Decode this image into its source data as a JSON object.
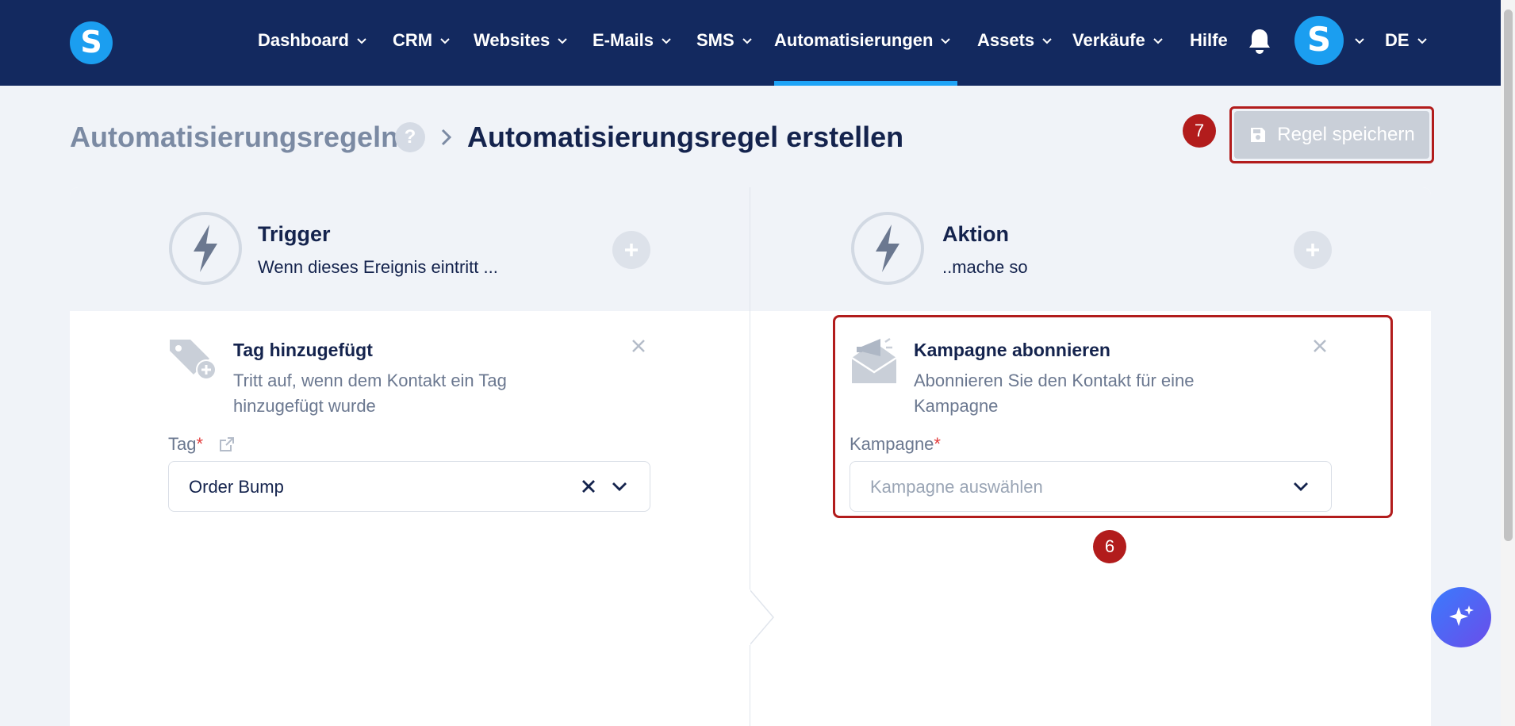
{
  "navbar": {
    "logo_letter": "S",
    "items": [
      {
        "label": "Dashboard"
      },
      {
        "label": "CRM"
      },
      {
        "label": "Websites"
      },
      {
        "label": "E-Mails"
      },
      {
        "label": "SMS"
      },
      {
        "label": "Automatisierungen",
        "active": true
      },
      {
        "label": "Assets"
      },
      {
        "label": "Verkäufe"
      },
      {
        "label": "Hilfe"
      }
    ],
    "avatar_letter": "S",
    "language": "DE",
    "accent_color": "#1ea4f7",
    "background_color": "#13295f"
  },
  "header": {
    "breadcrumb_root": "Automatisierungsregeln",
    "help_icon": "?",
    "breadcrumb_current": "Automatisierungsregel erstellen",
    "save_step": "7",
    "save_label": "Regel speichern"
  },
  "trigger": {
    "title": "Trigger",
    "subtitle": "Wenn dieses Ereignis eintritt ...",
    "card_title": "Tag hinzugefügt",
    "card_desc": "Tritt auf, wenn dem Kontakt ein Tag hinzugefügt wurde",
    "field_label": "Tag",
    "required_mark": "*",
    "field_value": "Order Bump"
  },
  "action": {
    "title": "Aktion",
    "subtitle": "..mache so",
    "card_title": "Kampagne abonnieren",
    "card_desc": "Abonnieren Sie den Kontakt für eine Kampagne",
    "field_label": "Kampagne",
    "required_mark": "*",
    "field_placeholder": "Kampagne auswählen",
    "step": "6"
  },
  "colors": {
    "highlight": "#b21c1c",
    "required": "#e23b3b"
  }
}
